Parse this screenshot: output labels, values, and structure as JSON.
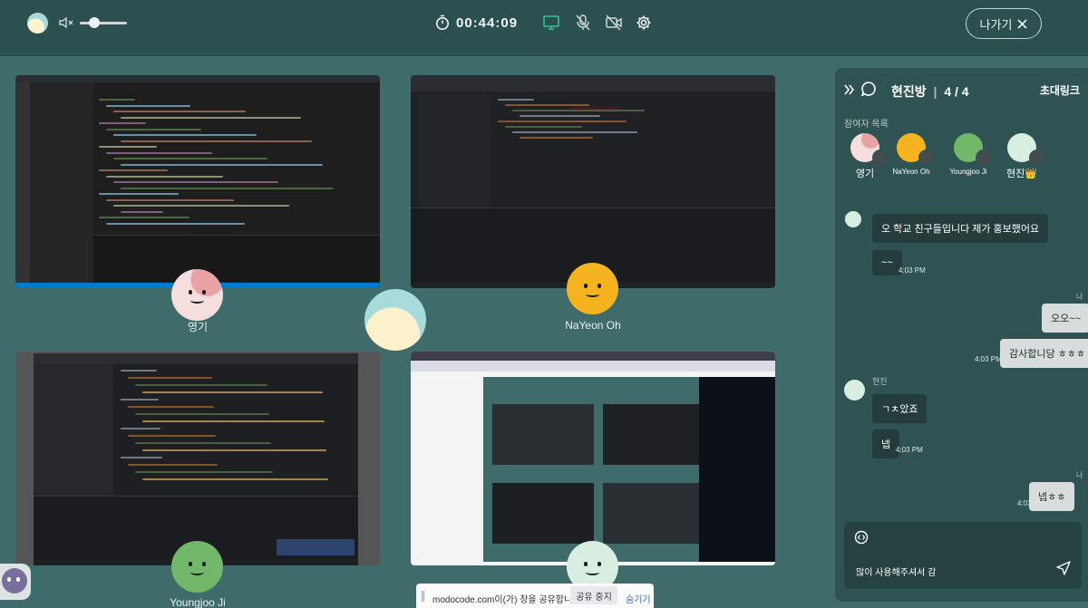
{
  "topbar": {
    "timer": "00:44:09",
    "exit_label": "나가기"
  },
  "tiles": [
    {
      "name": "영기"
    },
    {
      "name": "NaYeon Oh"
    },
    {
      "name": "Youngjoo Ji"
    }
  ],
  "panel": {
    "room_name": "현진방",
    "count": "4 / 4",
    "invite_link": "초대링크",
    "participants_label": "참여자 목록",
    "participants": [
      {
        "name": "영기"
      },
      {
        "name": "NaYeon Oh"
      },
      {
        "name": "Youngjoo Ji"
      },
      {
        "name": "현진👑"
      }
    ],
    "chat_label": "채팅",
    "messages": [
      {
        "text": "오 학교 친구들입니다 제가 홍보했어요"
      },
      {
        "text": "~~",
        "time": "4:03 PM"
      },
      {
        "sender": "나",
        "text": "오오~~"
      },
      {
        "text": "감사합니당 ㅎㅎㅎ",
        "time": "4:03 PM"
      },
      {
        "sender": "현진",
        "text": "ㄱㅊ았죠"
      },
      {
        "text": "넵",
        "time": "4:03 PM"
      },
      {
        "sender": "나",
        "text": "넵ㅎㅎ",
        "time": "4:03 PM"
      }
    ],
    "input_value": "많이 사용해주셔서 감"
  },
  "share_bar": {
    "message": "modocode.com이(가) 창을 공유합니다.",
    "stop_label": "공유 중지",
    "hide_label": "숨기기"
  },
  "colors": {
    "background": "#3f6b6a",
    "topbar": "#2c5050",
    "panel": "#2e5352",
    "accent_green": "#34c38f"
  }
}
